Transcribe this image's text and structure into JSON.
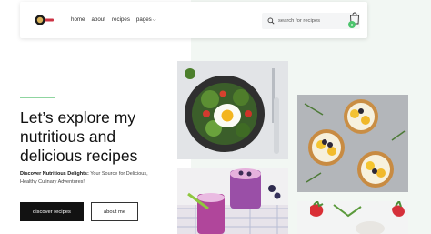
{
  "nav": {
    "items": [
      "home",
      "about",
      "recipes"
    ],
    "dropdown_label": "pages"
  },
  "search": {
    "placeholder": "search for recipes"
  },
  "cart": {
    "badge": "0"
  },
  "hero": {
    "title_lines": [
      "Let’s explore my",
      "nutritious and",
      "delicious recipes"
    ],
    "subtitle_bold": "Discover Nutritious Delights:",
    "subtitle_rest": " Your Source for Delicious, Healthy Culinary Adventures!",
    "primary_button": "discover recipes",
    "secondary_button": "about me"
  },
  "colors": {
    "accent": "#8fd5a0",
    "badge": "#4cc46d",
    "button_dark": "#121212",
    "panel_bg": "#f2f7f3"
  }
}
